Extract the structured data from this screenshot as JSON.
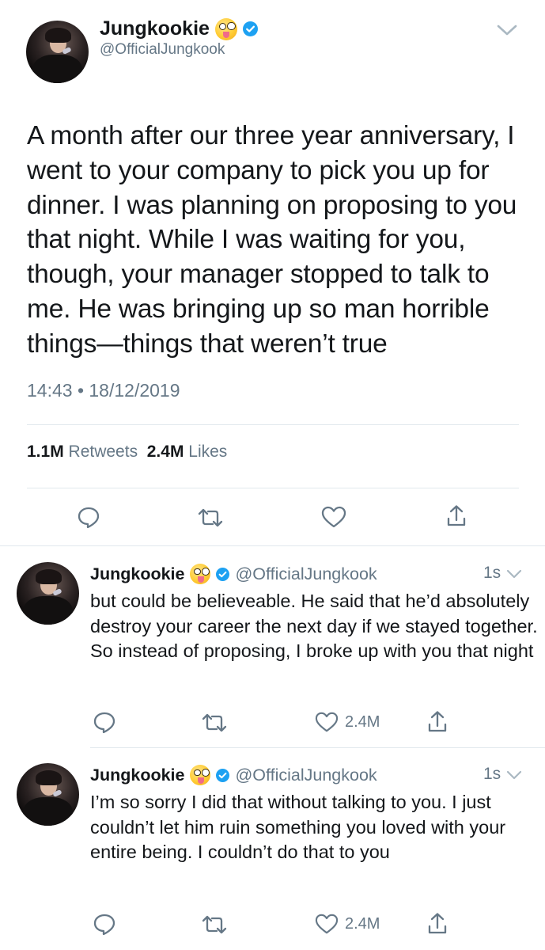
{
  "main_tweet": {
    "display_name": "Jungkookie",
    "handle": "@OfficialJungkook",
    "text": "A month after our three year anniversary, I went to your company to pick you up for dinner. I was planning on proposing to you that night. While I was waiting for you, though, your manager stopped to talk to me. He was bringing up so man horrible things—things that weren’t true",
    "timestamp": "14:43 • 18/12/2019",
    "retweets_count": "1.1M",
    "retweets_label": "Retweets",
    "likes_count": "2.4M",
    "likes_label": "Likes",
    "icons": [
      "reply-icon",
      "retweet-icon",
      "like-icon",
      "share-icon"
    ]
  },
  "replies": [
    {
      "display_name": "Jungkookie",
      "handle": "@OfficialJungkook",
      "time": "1s",
      "text": "but could be believeable. He said that he’d absolutely destroy your career the next day if we stayed together. So instead of proposing, I broke up with you that night",
      "like_count": "2.4M"
    },
    {
      "display_name": "Jungkookie",
      "handle": "@OfficialJungkook",
      "time": "1s",
      "text": "I’m so sorry I did that without talking to you. I just couldn’t let him ruin something you loved with your entire being. I couldn’t do that to you",
      "like_count": "2.4M"
    }
  ],
  "colors": {
    "text": "#14171a",
    "secondary": "#657786",
    "divider": "#e1e8ed",
    "verified": "#1da1f2"
  }
}
